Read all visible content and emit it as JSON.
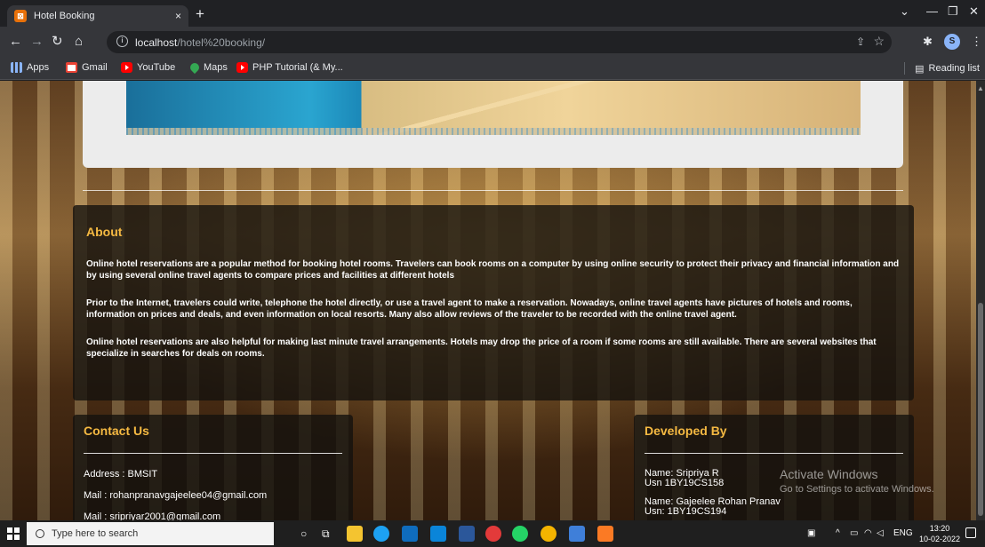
{
  "browser": {
    "tab_title": "Hotel Booking",
    "tab_close": "×",
    "new_tab": "+",
    "url_host": "localhost",
    "url_path": "/hotel%20booking/",
    "bookmarks": [
      "Apps",
      "Gmail",
      "YouTube",
      "Maps",
      "PHP Tutorial (& My..."
    ],
    "reading_list": "Reading list",
    "profile_initial": "S"
  },
  "about": {
    "heading": "About",
    "paragraphs": [
      "Online hotel reservations are a popular method for booking hotel rooms. Travelers can book rooms on a computer by using online security to protect their privacy and financial information and by using several online travel agents to compare prices and facilities at different hotels",
      "Prior to the Internet, travelers could write, telephone the hotel directly, or use a travel agent to make a reservation. Nowadays, online travel agents have pictures of hotels and rooms, information on prices and deals, and even information on local resorts. Many also allow reviews of the traveler to be recorded with the online travel agent.",
      "Online hotel reservations are also helpful for making last minute travel arrangements. Hotels may drop the price of a room if some rooms are still available. There are several websites that specialize in searches for deals on rooms."
    ]
  },
  "contact": {
    "heading": "Contact Us",
    "address": "Address : BMSIT",
    "mail1": "Mail : rohanpranavgajeelee04@gmail.com",
    "mail2": "Mail : sripriyar2001@gmail.com"
  },
  "developed": {
    "heading": "Developed By",
    "dev1_name": "Name: Sripriya R",
    "dev1_usn": "Usn 1BY19CS158",
    "dev2_name": "Name: Gajeelee Rohan Pranav",
    "dev2_usn": "Usn: 1BY19CS194"
  },
  "watermark": {
    "title": "Activate Windows",
    "subtitle": "Go to Settings to activate Windows."
  },
  "taskbar": {
    "search_placeholder": "Type here to search",
    "lang": "ENG",
    "time": "13:20",
    "date": "10-02-2022"
  }
}
